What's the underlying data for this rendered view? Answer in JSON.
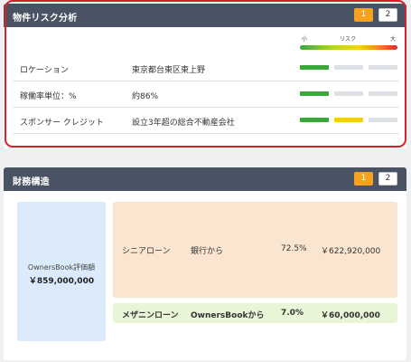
{
  "risk_panel": {
    "title": "物件リスク分析",
    "pages": [
      "1",
      "2"
    ],
    "scale": {
      "low": "小",
      "mid": "リスク",
      "high": "大"
    },
    "rows": [
      {
        "label": "ロケーション",
        "value": "東京都台東区東上野",
        "level": 1
      },
      {
        "label": "稼働率単位：%",
        "value": "約86%",
        "level": 1
      },
      {
        "label": "スポンサー クレジット",
        "value": "設立3年超の総合不動産会社",
        "level": 2
      }
    ],
    "colors": {
      "low": "#3aa93a",
      "medium": "#f6cf14",
      "empty": "#dde1e6",
      "highlight": "#d8202a"
    }
  },
  "finance_panel": {
    "title": "財務構造",
    "pages": [
      "1",
      "2"
    ],
    "valuation": {
      "label": "OwnersBook評価額",
      "amount": "￥859,000,000"
    },
    "senior_loan": {
      "name": "シニアローン",
      "source": "銀行から",
      "ratio": "72.5%",
      "amount": "￥622,920,000"
    },
    "mezzanine_loan": {
      "name": "メザニンローン",
      "source": "OwnersBookから",
      "ratio": "7.0%",
      "amount": "￥60,000,000"
    }
  }
}
